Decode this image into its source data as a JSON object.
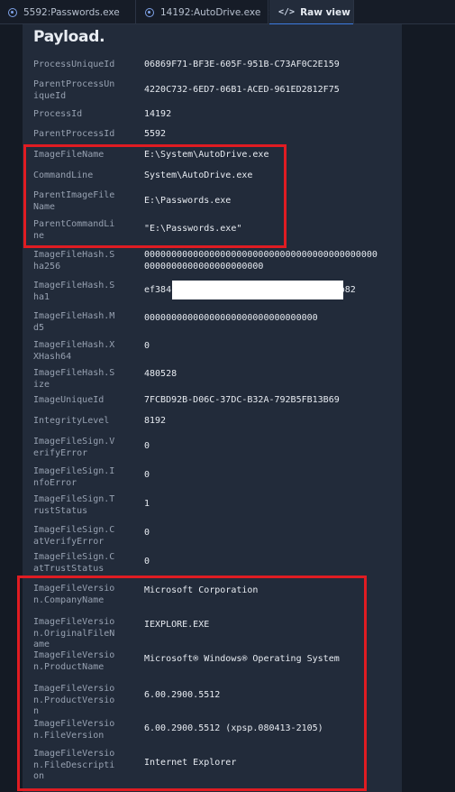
{
  "tabs": [
    {
      "label": "5592:Passwords.exe"
    },
    {
      "label": "14192:AutoDrive.exe",
      "close": "×"
    },
    {
      "label": "Raw view",
      "icon": "</>"
    }
  ],
  "title": "Payload.",
  "fields": [
    {
      "key": "ProcessUniqueId",
      "value": "06869F71-BF3E-605F-951B-C73AF0C2E159"
    },
    {
      "key": "ParentProcessUn\niqueId",
      "value": "4220C732-6ED7-06B1-ACED-961ED2812F75"
    },
    {
      "key": "ProcessId",
      "value": "14192"
    },
    {
      "key": "ParentProcessId",
      "value": "5592"
    },
    {
      "key": "ImageFileName",
      "value": "E:\\System\\AutoDrive.exe"
    },
    {
      "key": "CommandLine",
      "value": "System\\AutoDrive.exe"
    },
    {
      "key": "ParentImageFile\nName",
      "value": "E:\\Passwords.exe"
    },
    {
      "key": "ParentCommandLi\nne",
      "value": "\"E:\\Passwords.exe\""
    },
    {
      "key": "ImageFileHash.S\nha256",
      "value": "0000000000000000000000000000000000000000000\n0000000000000000000000"
    },
    {
      "key": "ImageFileHash.S\nha1",
      "value": "ef384                              0b82"
    },
    {
      "key": "ImageFileHash.M\nd5",
      "value": "00000000000000000000000000000000"
    },
    {
      "key": "ImageFileHash.X\nXHash64",
      "value": "0"
    },
    {
      "key": "ImageFileHash.S\nize",
      "value": "480528"
    },
    {
      "key": "ImageUniqueId",
      "value": "7FCBD92B-D06C-37DC-B32A-792B5FB13B69"
    },
    {
      "key": "IntegrityLevel",
      "value": "8192"
    },
    {
      "key": "ImageFileSign.V\nerifyError",
      "value": "0"
    },
    {
      "key": "ImageFileSign.I\nnfoError",
      "value": "0"
    },
    {
      "key": "ImageFileSign.T\nrustStatus",
      "value": "1"
    },
    {
      "key": "ImageFileSign.C\natVerifyError",
      "value": "0"
    },
    {
      "key": "ImageFileSign.C\natTrustStatus",
      "value": "0"
    },
    {
      "key": "ImageFileVersio\nn.CompanyName",
      "value": "Microsoft Corporation"
    },
    {
      "key": "ImageFileVersio\nn.OriginalFileN\name",
      "value": "IEXPLORE.EXE"
    },
    {
      "key": "ImageFileVersio\nn.ProductName",
      "value": "Microsoft® Windows® Operating System"
    },
    {
      "key": "ImageFileVersio\nn.ProductVersio\nn",
      "value": "6.00.2900.5512"
    },
    {
      "key": "ImageFileVersio\nn.FileVersion",
      "value": "6.00.2900.5512 (xpsp.080413-2105)"
    },
    {
      "key": "ImageFileVersio\nn.FileDescripti\non",
      "value": "Internet Explorer"
    }
  ],
  "colors": {
    "highlight": "#e01c22",
    "accent": "#3d7be0"
  }
}
